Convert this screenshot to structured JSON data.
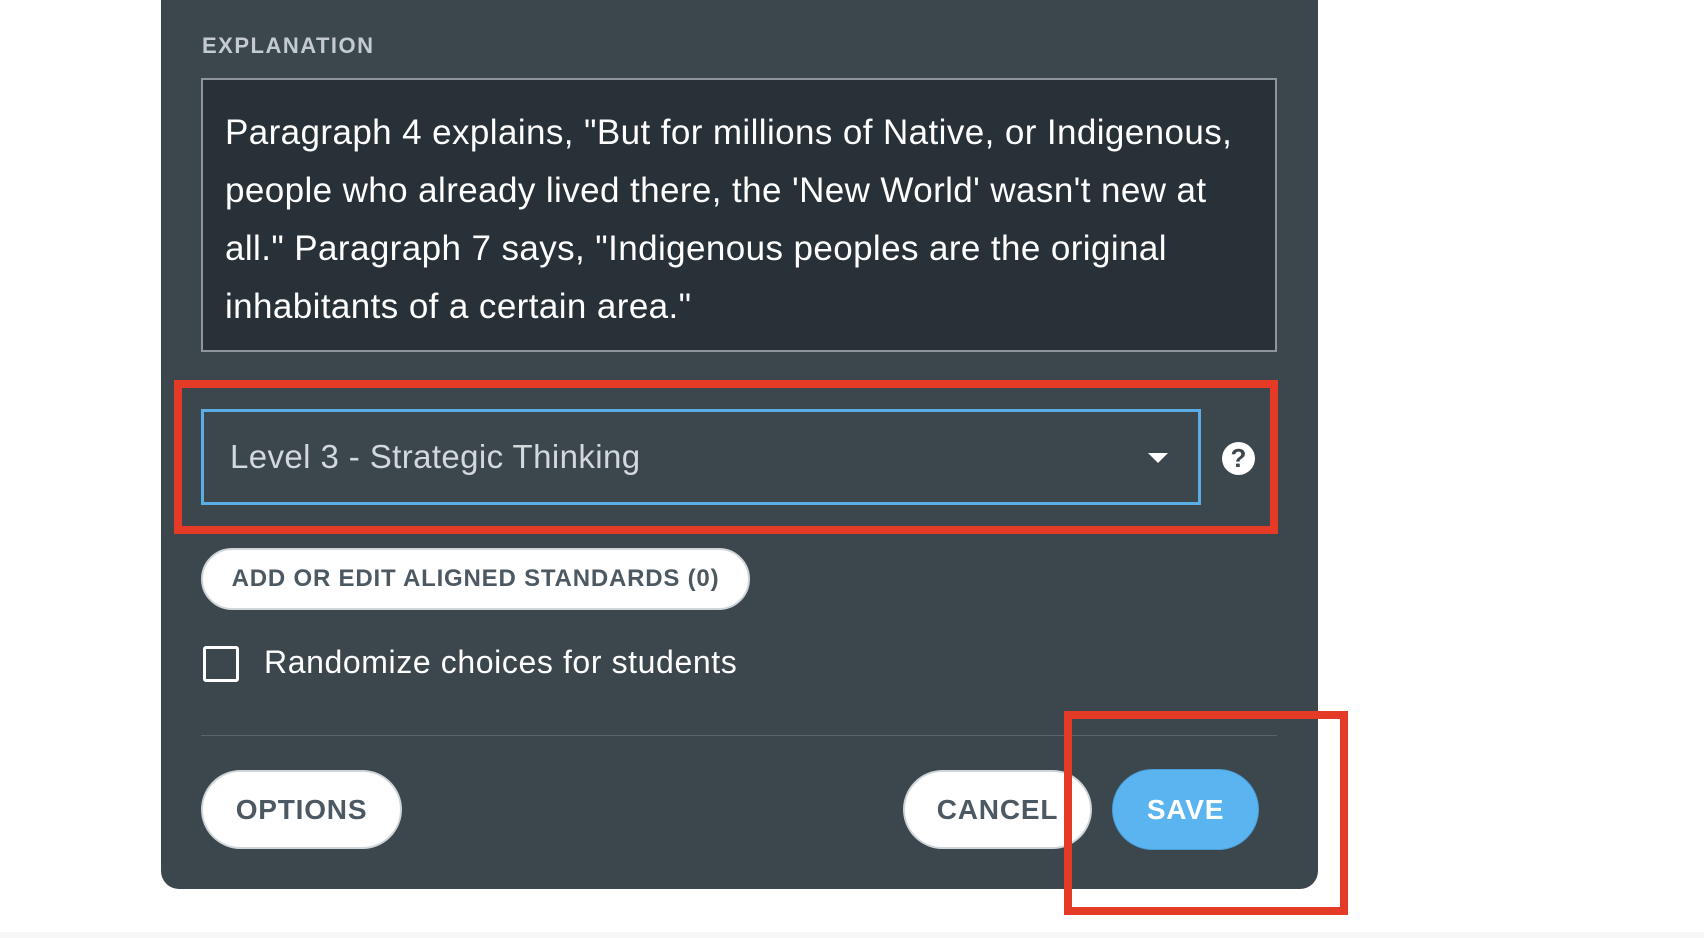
{
  "explanation": {
    "label": "EXPLANATION",
    "text": "Paragraph 4 explains, \"But for millions of Native, or Indigenous, people who already lived there, the 'New World' wasn't new at all.\" Paragraph 7 says, \"Indigenous peoples are the original inhabitants of a certain area.\""
  },
  "dok_select": {
    "selected": "Level 3 - Strategic Thinking",
    "caret_icon": "caret-down-icon",
    "help_icon": "question-circle-icon",
    "help_glyph": "?"
  },
  "standards": {
    "button_label": "ADD OR EDIT ALIGNED STANDARDS (0)"
  },
  "randomize": {
    "label": "Randomize choices for students",
    "checked": false
  },
  "footer": {
    "options_label": "OPTIONS",
    "cancel_label": "CANCEL",
    "save_label": "SAVE"
  },
  "colors": {
    "panel_bg": "#3c464d",
    "textarea_bg": "#283038",
    "select_border": "#5aaee6",
    "save_bg": "#5ab4ef",
    "highlight": "#e53b26"
  }
}
